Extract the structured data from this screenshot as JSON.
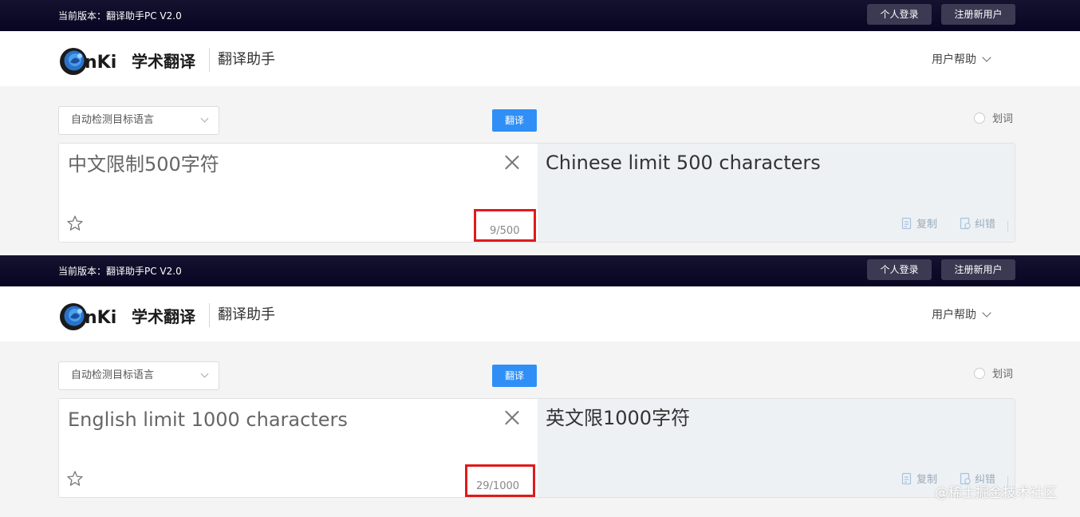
{
  "panels": [
    {
      "version_text": "当前版本：翻译助手PC V2.0",
      "login_label": "个人登录",
      "register_label": "注册新用户",
      "app_name": "翻译助手",
      "logo_text": "学术翻译",
      "help_label": "用户帮助",
      "language_select": "自动检测目标语言",
      "translate_label": "翻译",
      "huaci_label": "划词",
      "source_text": "中文限制500字符",
      "char_count": "9/500",
      "target_text": "Chinese limit 500 characters",
      "copy_label": "复制",
      "correct_label": "纠错"
    },
    {
      "version_text": "当前版本：翻译助手PC V2.0",
      "login_label": "个人登录",
      "register_label": "注册新用户",
      "app_name": "翻译助手",
      "logo_text": "学术翻译",
      "help_label": "用户帮助",
      "language_select": "自动检测目标语言",
      "translate_label": "翻译",
      "huaci_label": "划词",
      "source_text": "English limit 1000 characters",
      "char_count": "29/1000",
      "target_text": "英文限1000字符",
      "copy_label": "复制",
      "correct_label": "纠错"
    }
  ],
  "watermark": "@稀土掘金技术社区",
  "icons": [
    "chevron-down-icon",
    "radio-icon",
    "close-icon",
    "star-icon",
    "copy-icon",
    "correct-icon",
    "cnki-globe-icon"
  ],
  "colors": {
    "topbar": "#070521",
    "accent": "#2f8ff6",
    "highlight": "#e0191b",
    "target_bg": "#eef1f4"
  }
}
